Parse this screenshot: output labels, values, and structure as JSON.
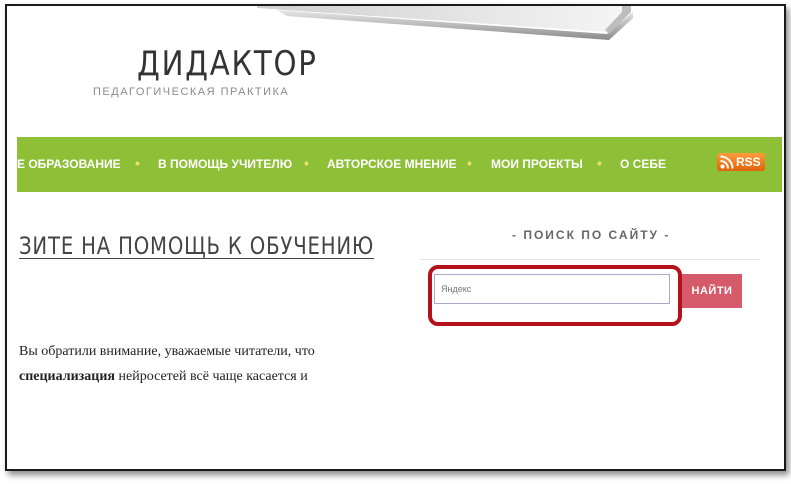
{
  "header": {
    "title": "ДИДАКТОР",
    "tagline": "ПЕДАГОГИЧЕСКАЯ ПРАКТИКА"
  },
  "nav": {
    "items": [
      {
        "label": "Е ОБРАЗОВАНИЕ"
      },
      {
        "label": "В ПОМОЩЬ УЧИТЕЛЮ"
      },
      {
        "label": "АВТОРСКОЕ МНЕНИЕ"
      },
      {
        "label": "МОИ ПРОЕКТЫ"
      },
      {
        "label": "О СЕБЕ"
      }
    ],
    "separator": "•",
    "rss_label": "RSS"
  },
  "post": {
    "title": "ЗИТЕ НА ПОМОЩЬ К ОБУЧЕНИЮ",
    "line1": "Вы обратили внимание, уважаемые читатели, что",
    "line2_bold": "специализация",
    "line2_rest": " нейросетей всё чаще касается и"
  },
  "sidebar": {
    "search_heading": "- ПОИСК ПО САЙТУ -",
    "search_placeholder": "Яндекс",
    "search_button": "НАЙТИ"
  },
  "colors": {
    "nav_bg": "#8dbf37",
    "nav_dot": "#f0e060",
    "button_bg": "#d55a6a",
    "highlight": "#b5111c",
    "rss": "#f07d1a"
  },
  "icons": {
    "rss": "rss-icon",
    "laptop": "laptop-graphic"
  }
}
